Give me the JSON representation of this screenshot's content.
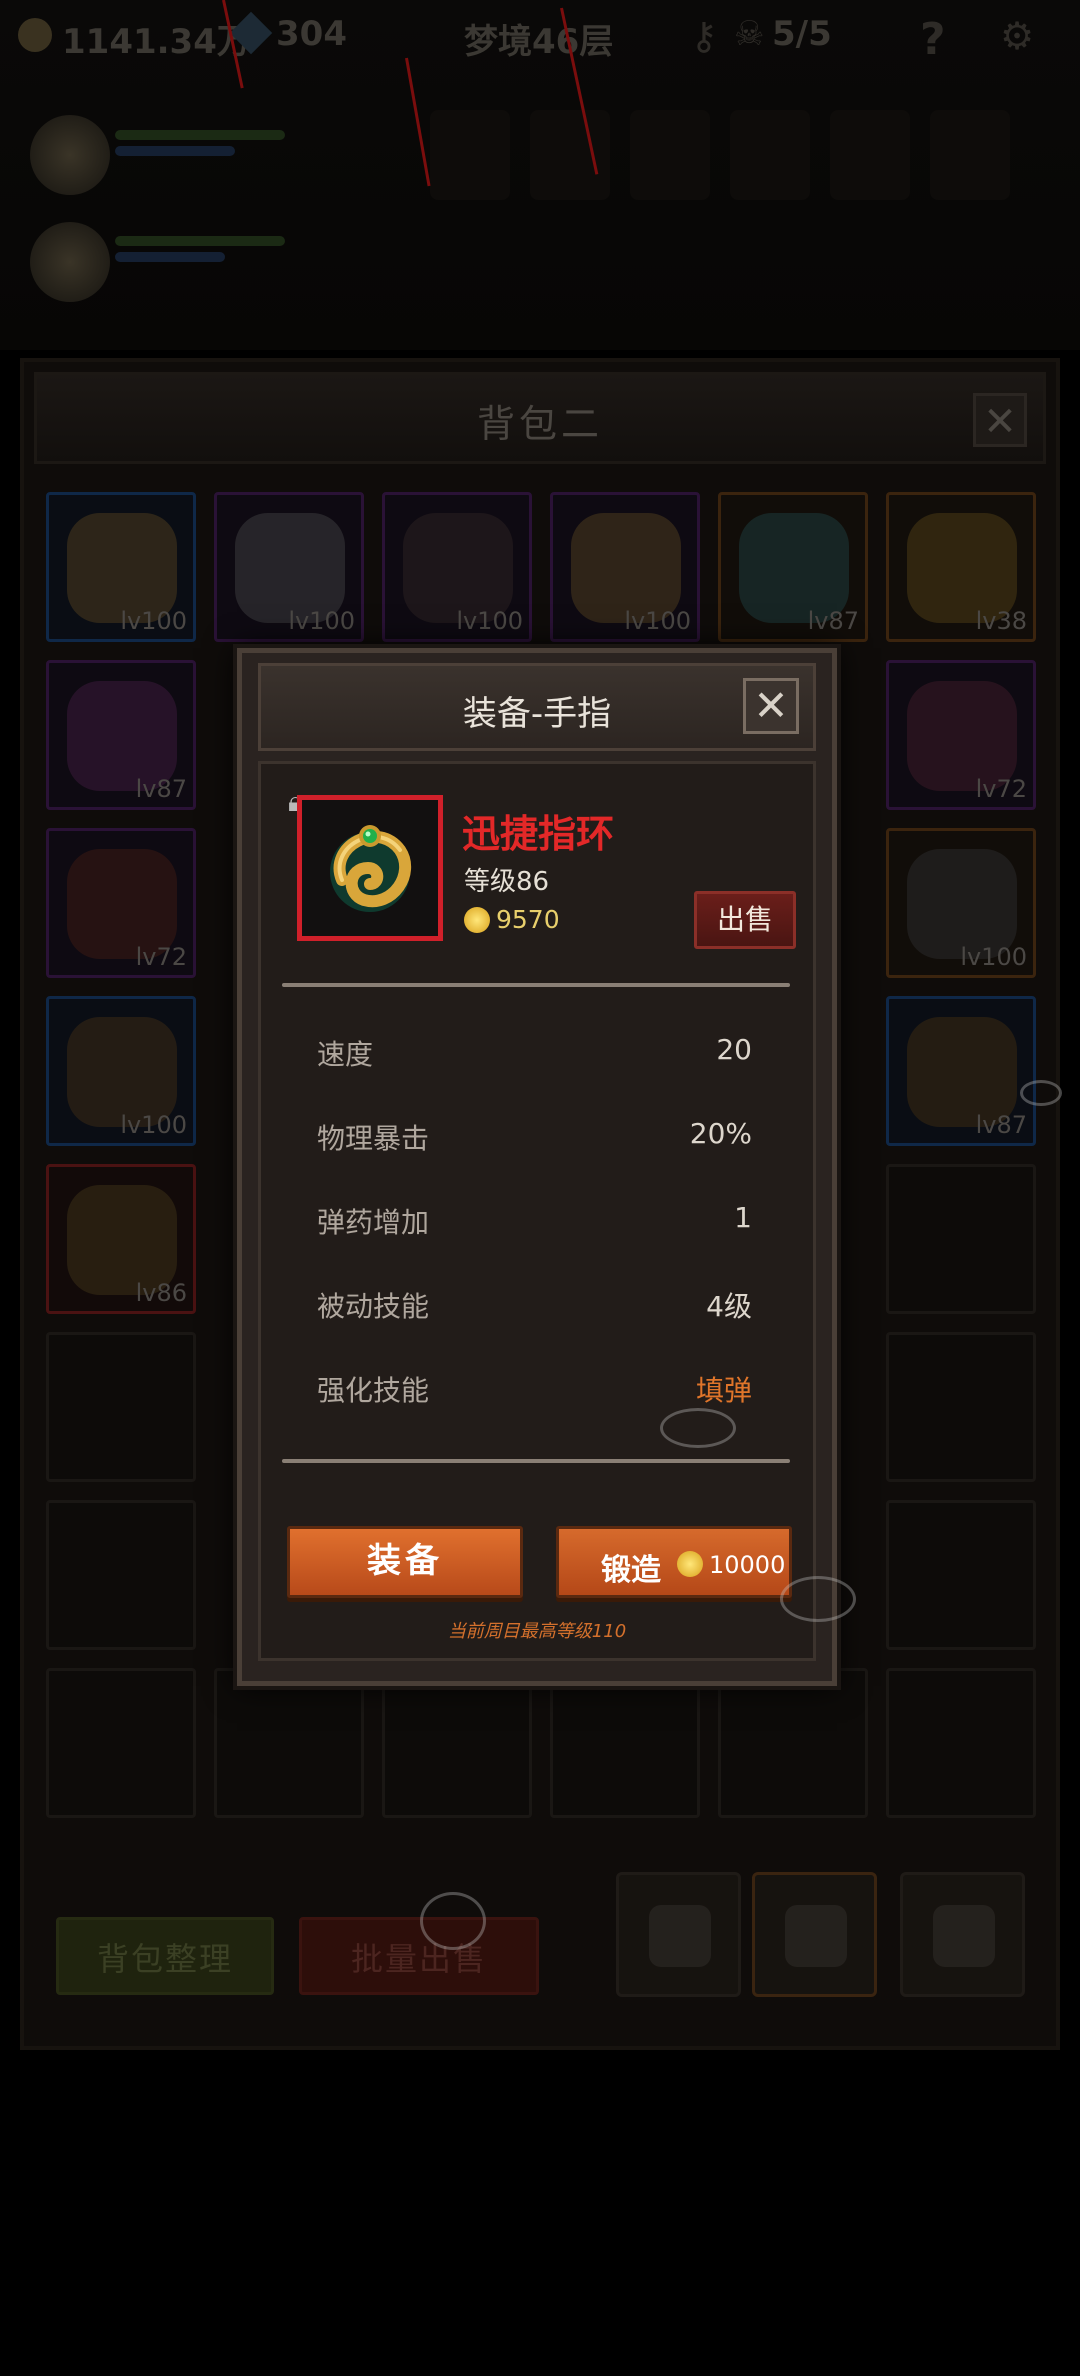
{
  "hud": {
    "gold": "1141.34万",
    "gems": "304",
    "stage": "梦境46层",
    "skulls": "5/5",
    "help_glyph": "?"
  },
  "bag": {
    "title": "背包二",
    "close_glyph": "✕",
    "slots_row1": [
      "lv100",
      "lv100",
      "lv100",
      "lv100",
      "lv87",
      "lv38"
    ],
    "slots_row2": [
      "lv87",
      "",
      "",
      "",
      "",
      "lv72"
    ],
    "slots_row3": [
      "lv72",
      "",
      "",
      "",
      "",
      "lv100"
    ],
    "slots_row4": [
      "lv100",
      "",
      "",
      "",
      "",
      "lv87"
    ],
    "slots_row5": [
      "lv86",
      "",
      "",
      "",
      "",
      ""
    ],
    "sort_button": "背包整理",
    "batch_sell_button": "批量出售"
  },
  "modal": {
    "title": "装备-手指",
    "close_glyph": "✕",
    "item": {
      "name": "迅捷指环",
      "level_text": "等级86",
      "sell_price": "9570",
      "sell_button": "出售",
      "icon": "ring-icon",
      "locked_icon": "lock-icon"
    },
    "stats": [
      {
        "label": "速度",
        "value": "20"
      },
      {
        "label": "物理暴击",
        "value": "20%"
      },
      {
        "label": "弹药增加",
        "value": "1"
      },
      {
        "label": "被动技能",
        "value": "4级"
      },
      {
        "label": "强化技能",
        "value": "填弹"
      }
    ],
    "equip_button": "装备",
    "forge_button": "锻造",
    "forge_cost": "10000",
    "max_level_note": "当前周目最高等级110"
  },
  "colors": {
    "item_name": "#e32828",
    "accent_orange": "#e0702e",
    "gold_text": "#e8cf6c"
  }
}
